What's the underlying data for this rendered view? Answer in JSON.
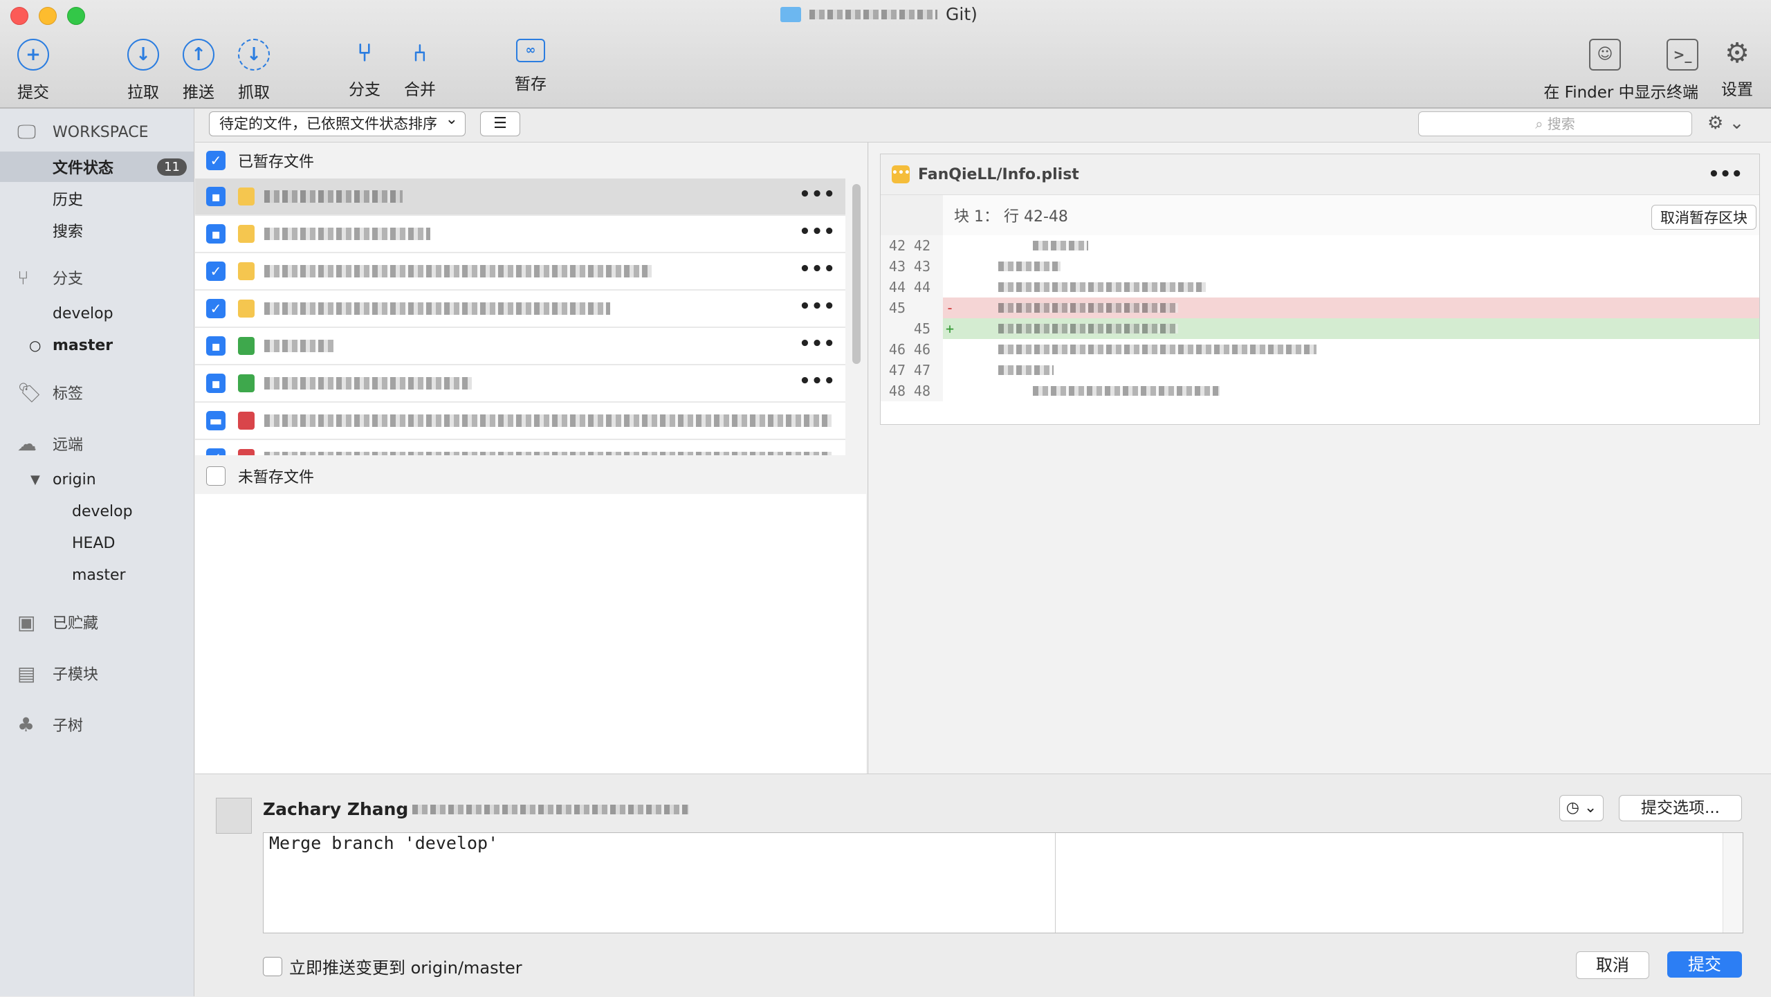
{
  "window": {
    "title_suffix": "Git)"
  },
  "toolbar": {
    "commit": "提交",
    "pull": "拉取",
    "push": "推送",
    "fetch": "抓取",
    "branch": "分支",
    "merge": "合并",
    "stash": "暂存",
    "show_in_finder": "在 Finder 中显示",
    "terminal": "终端",
    "settings": "设置"
  },
  "sidebar": {
    "workspace": "WORKSPACE",
    "file_status": "文件状态",
    "file_status_count": "11",
    "history": "历史",
    "search": "搜索",
    "branches": "分支",
    "branch_items": [
      "develop",
      "master"
    ],
    "tags": "标签",
    "remotes": "远端",
    "origin": "origin",
    "origin_items": [
      "develop",
      "HEAD",
      "master"
    ],
    "stashes": "已贮藏",
    "submodules": "子模块",
    "subtrees": "子树"
  },
  "filebar": {
    "sort_dropdown": "待定的文件，已依照文件状态排序",
    "search_placeholder": "搜索"
  },
  "files": {
    "staged_header": "已暂存文件",
    "unstaged_header": "未暂存文件"
  },
  "diff": {
    "filename": "FanQieLL/Info.plist",
    "hunk_label": "块 1：  行 42-48",
    "unstage_hunk": "取消暂存区块",
    "old_lines": [
      "42",
      "43",
      "44",
      "45",
      "",
      "46",
      "47",
      "48"
    ],
    "new_lines": [
      "42",
      "43",
      "44",
      "",
      "45",
      "46",
      "47",
      "48"
    ]
  },
  "commit": {
    "author": "Zachary Zhang",
    "message": "Merge branch 'develop'",
    "options": "提交选项...",
    "push_label": "立即推送变更到 origin/master",
    "cancel": "取消",
    "submit": "提交"
  },
  "colors": {
    "accent": "#2c7ef4",
    "delete_bg": "#f5d5d5",
    "add_bg": "#d4ecd1"
  }
}
